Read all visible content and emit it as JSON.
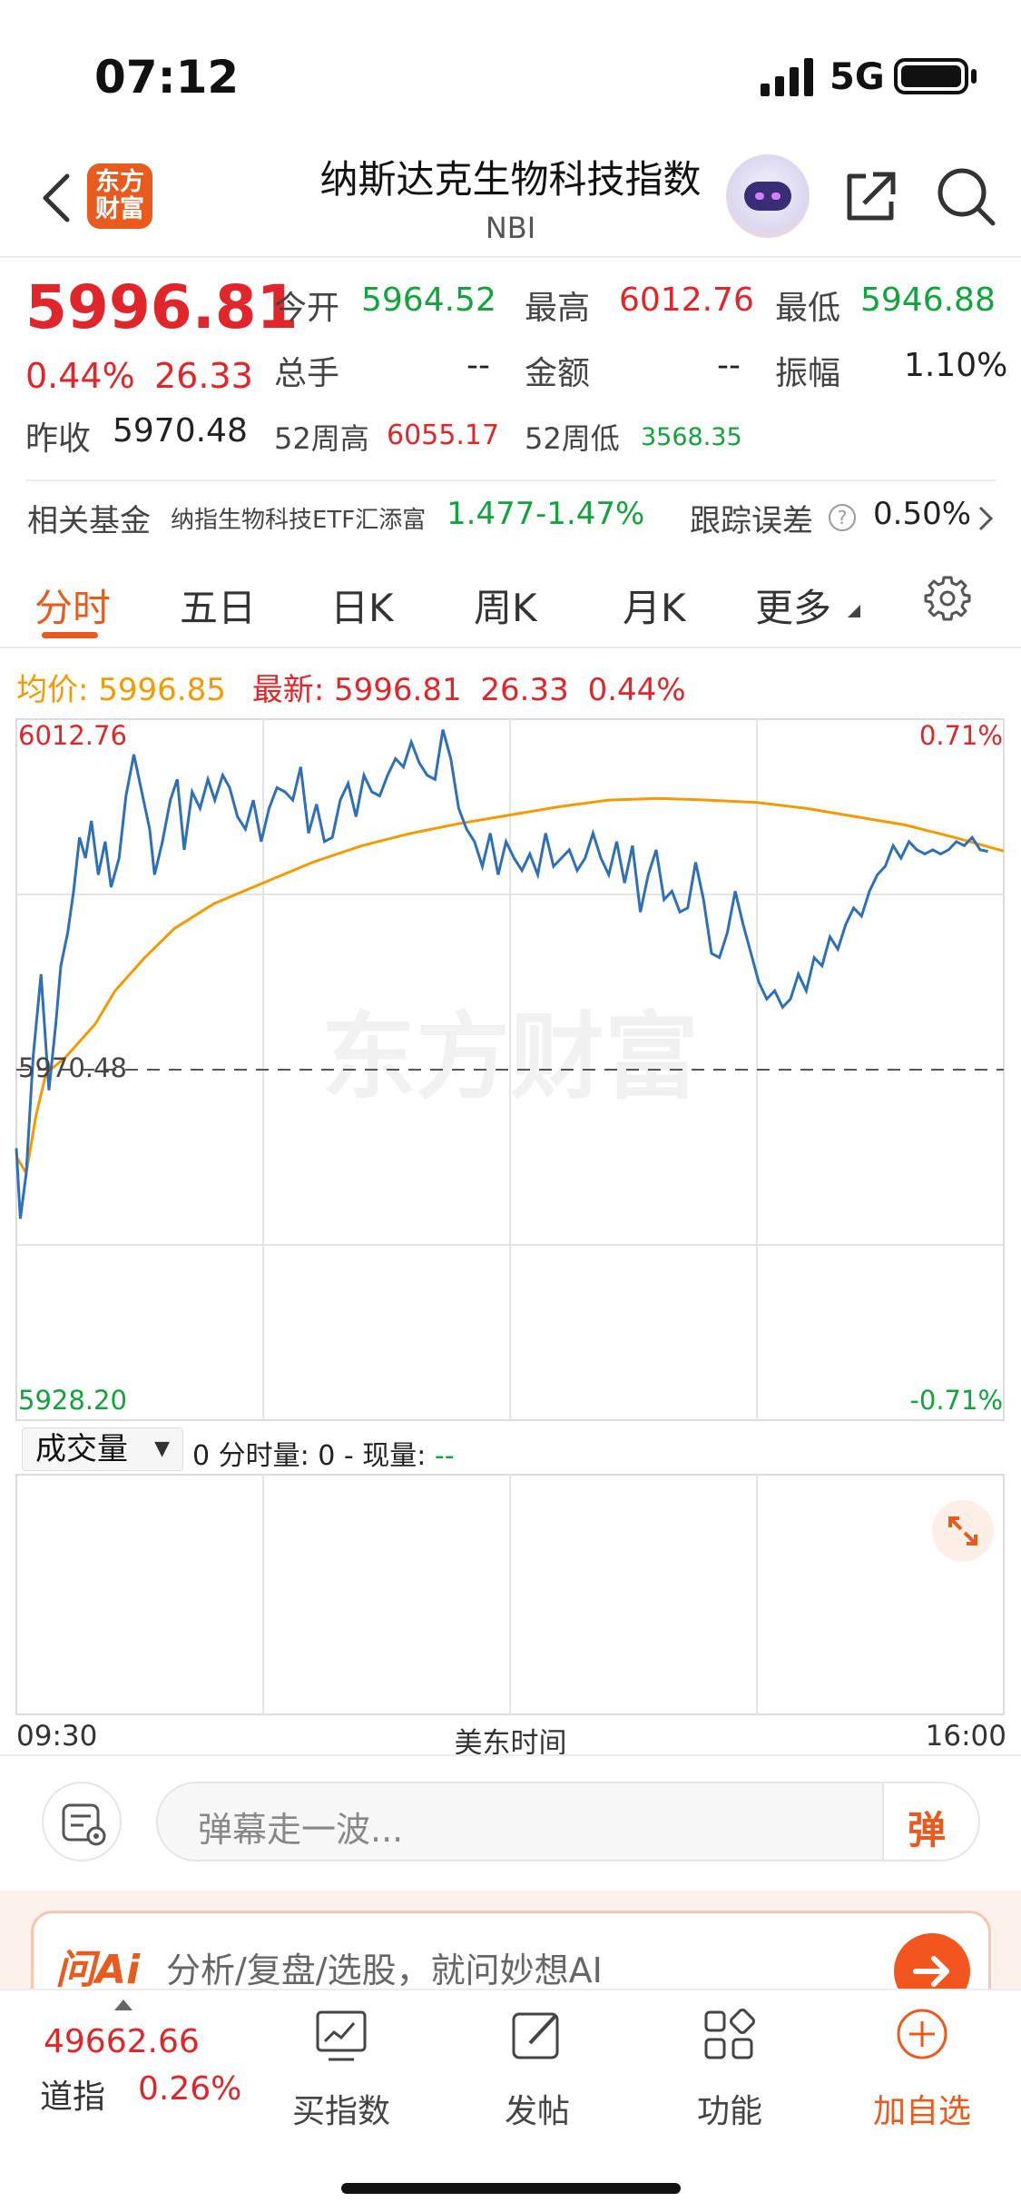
{
  "status_bar": {
    "time": "07:12",
    "network": "5G"
  },
  "header": {
    "logo_text": "东方财富",
    "title": "纳斯达克生物科技指数",
    "subtitle": "NBI"
  },
  "quote": {
    "price": "5996.81",
    "change_pct": "0.44%",
    "change": "26.33",
    "open_label": "今开",
    "open": "5964.52",
    "high_label": "最高",
    "high": "6012.76",
    "low_label": "最低",
    "low": "5946.88",
    "volume_label": "总手",
    "volume": "--",
    "amount_label": "金额",
    "amount": "--",
    "amplitude_label": "振幅",
    "amplitude": "1.10%",
    "prev_close_label": "昨收",
    "prev_close": "5970.48",
    "w52_high_label": "52周高",
    "w52_high": "6055.17",
    "w52_low_label": "52周低",
    "w52_low": "3568.35"
  },
  "fund": {
    "label": "相关基金",
    "name": "纳指生物科技ETF汇添富",
    "price": "1.477",
    "change_pct": "-1.47%",
    "tracking_label": "跟踪误差",
    "tracking_value": "0.50%"
  },
  "tabs": [
    "分时",
    "五日",
    "日K",
    "周K",
    "月K",
    "更多"
  ],
  "chart_info": {
    "avg_label": "均价:",
    "avg_value": "5996.85",
    "latest_label": "最新:",
    "latest_value": "5996.81",
    "latest_change": "26.33",
    "latest_pct": "0.44%"
  },
  "chart_data": {
    "type": "line",
    "y_top_label": "6012.76",
    "y_mid_label": "5970.48",
    "y_bottom_label": "5928.20",
    "pct_top_label": "0.71%",
    "pct_bottom_label": "-0.71%",
    "ylim": [
      5928.2,
      6012.76
    ],
    "reference_line": 5970.48,
    "watermark": "东方财富",
    "x_start": "09:30",
    "x_end": "16:00",
    "x_label": "美东时间",
    "series": [
      {
        "name": "最新",
        "color": "#2e6fb7",
        "x_fraction": [
          0,
          0.004,
          0.01,
          0.017,
          0.025,
          0.033,
          0.04,
          0.045,
          0.052,
          0.058,
          0.064,
          0.07,
          0.076,
          0.083,
          0.09,
          0.096,
          0.104,
          0.111,
          0.119,
          0.127,
          0.135,
          0.14,
          0.148,
          0.156,
          0.163,
          0.17,
          0.178,
          0.186,
          0.194,
          0.201,
          0.209,
          0.216,
          0.224,
          0.232,
          0.24,
          0.248,
          0.256,
          0.264,
          0.272,
          0.28,
          0.288,
          0.296,
          0.304,
          0.312,
          0.32,
          0.328,
          0.336,
          0.344,
          0.352,
          0.36,
          0.368,
          0.376,
          0.384,
          0.392,
          0.4,
          0.408,
          0.416,
          0.424,
          0.432,
          0.44,
          0.448,
          0.456,
          0.464,
          0.472,
          0.48,
          0.488,
          0.496,
          0.504,
          0.512,
          0.52,
          0.528,
          0.536,
          0.544,
          0.552,
          0.56,
          0.568,
          0.576,
          0.584,
          0.592,
          0.6,
          0.608,
          0.616,
          0.624,
          0.632,
          0.64,
          0.648,
          0.656,
          0.664,
          0.672,
          0.68,
          0.688,
          0.696,
          0.704,
          0.712,
          0.72,
          0.728,
          0.736,
          0.744,
          0.752,
          0.76,
          0.768,
          0.776,
          0.784,
          0.792,
          0.8,
          0.808,
          0.816,
          0.824,
          0.832,
          0.84,
          0.848,
          0.856,
          0.864,
          0.872,
          0.88,
          0.888,
          0.896,
          0.904,
          0.912,
          0.92,
          0.928,
          0.936,
          0.944,
          0.952,
          0.96,
          0.968,
          0.976,
          0.984,
          0.992,
          1.0
        ],
        "values": [
          5961.0,
          5952.5,
          5958.0,
          5972.0,
          5982.0,
          5968.0,
          5976.0,
          5983.0,
          5987.0,
          5992.0,
          5998.5,
          5996.0,
          6000.5,
          5994.0,
          5998.0,
          5992.5,
          5996.0,
          6003.5,
          6008.5,
          6004.0,
          5999.5,
          5994.0,
          5998.0,
          6003.0,
          6005.5,
          5997.0,
          6004.0,
          6002.0,
          6005.5,
          6003.0,
          6006.0,
          6004.5,
          6001.0,
          5999.5,
          6003.0,
          5998.0,
          6002.0,
          6004.5,
          6004.0,
          6003.0,
          6007.0,
          5999.0,
          6002.5,
          5998.0,
          5998.5,
          6003.0,
          6005.0,
          6001.0,
          6006.0,
          6004.0,
          6003.5,
          6006.0,
          6008.0,
          6007.0,
          6010.0,
          6007.5,
          6006.0,
          6005.5,
          6011.5,
          6008.0,
          6002.0,
          5999.5,
          5998.0,
          5995.0,
          5999.0,
          5994.0,
          5998.0,
          5996.0,
          5994.5,
          5996.5,
          5994.0,
          5999.0,
          5995.0,
          5996.0,
          5997.0,
          5994.5,
          5996.0,
          5999.0,
          5996.0,
          5994.0,
          5998.0,
          5993.0,
          5997.5,
          5989.5,
          5994.0,
          5997.0,
          5991.0,
          5992.0,
          5989.5,
          5990.0,
          5995.5,
          5991.0,
          5984.5,
          5984.0,
          5987.0,
          5992.0,
          5988.0,
          5984.5,
          5981.0,
          5979.0,
          5980.0,
          5978.0,
          5979.0,
          5982.0,
          5980.0,
          5984.0,
          5983.0,
          5986.5,
          5985.0,
          5988.0,
          5990.0,
          5989.0,
          5992.0,
          5994.0,
          5995.0,
          5997.5,
          5996.0,
          5998.0,
          5997.0,
          5996.5,
          5997.0,
          5996.5,
          5997.0,
          5998.0,
          5997.5,
          5998.5,
          5997.0,
          5996.81
        ]
      },
      {
        "name": "均价",
        "color": "#f39a00",
        "x_fraction": [
          0,
          0.01,
          0.02,
          0.03,
          0.05,
          0.08,
          0.1,
          0.13,
          0.16,
          0.2,
          0.25,
          0.3,
          0.35,
          0.4,
          0.45,
          0.5,
          0.55,
          0.6,
          0.65,
          0.7,
          0.75,
          0.8,
          0.85,
          0.9,
          0.95,
          1.0
        ],
        "values": [
          5960.0,
          5958.0,
          5965.0,
          5970.0,
          5972.0,
          5976.0,
          5980.0,
          5984.0,
          5987.5,
          5990.5,
          5993.0,
          5995.5,
          5997.5,
          5999.0,
          6000.2,
          6001.2,
          6002.2,
          6003.0,
          6003.2,
          6003.0,
          6002.7,
          6002.0,
          6001.0,
          6000.0,
          5998.5,
          5996.85
        ]
      }
    ]
  },
  "volume": {
    "selector": "成交量",
    "info_label": "0 分时量: 0 - 现量:",
    "info_value": "--"
  },
  "danmaku": {
    "placeholder": "弹幕走一波...",
    "button": "弹"
  },
  "ai_bar": {
    "logo": "问Ai",
    "text": "分析/复盘/选股，就问妙想AI"
  },
  "bottom_nav": {
    "index_value": "49662.66",
    "index_name": "道指",
    "index_pct": "0.26%",
    "items": [
      "买指数",
      "发帖",
      "功能",
      "加自选"
    ]
  },
  "colors": {
    "up": "#e0262b",
    "down": "#13a33c",
    "accent": "#e85a1e",
    "avg_line": "#f39a00",
    "price_line": "#2e6fb7"
  }
}
